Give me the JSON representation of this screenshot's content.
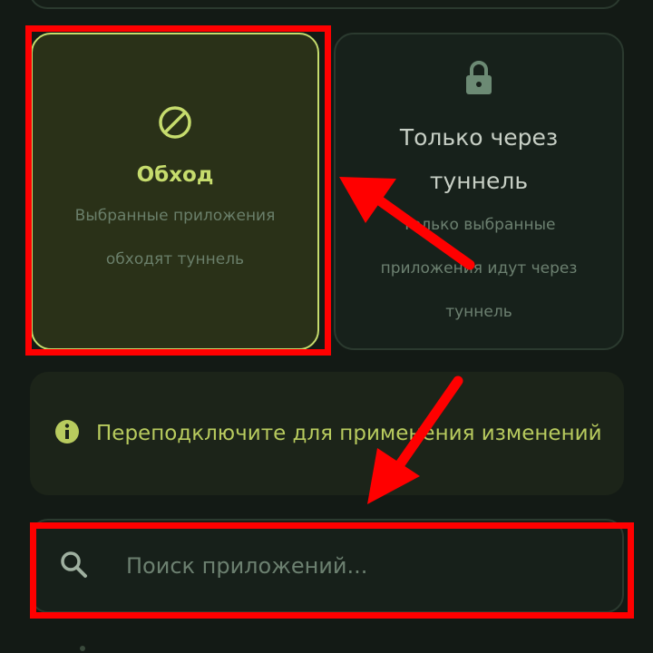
{
  "modes": {
    "bypass": {
      "title": "Обход",
      "description": "Выбранные приложения обходят туннель",
      "icon": "block-icon",
      "selected": true
    },
    "tunnel_only": {
      "title": "Только через туннель",
      "description": "Только выбранные приложения идут через туннель",
      "icon": "lock-icon",
      "selected": false
    }
  },
  "notice": {
    "text": "Переподключите для применения изменений",
    "icon": "info-icon"
  },
  "search": {
    "placeholder": "Поиск приложений...",
    "icon": "search-icon"
  },
  "colors": {
    "accent": "#c6dc6d",
    "background": "#131a15",
    "annotation": "#ff0000"
  }
}
